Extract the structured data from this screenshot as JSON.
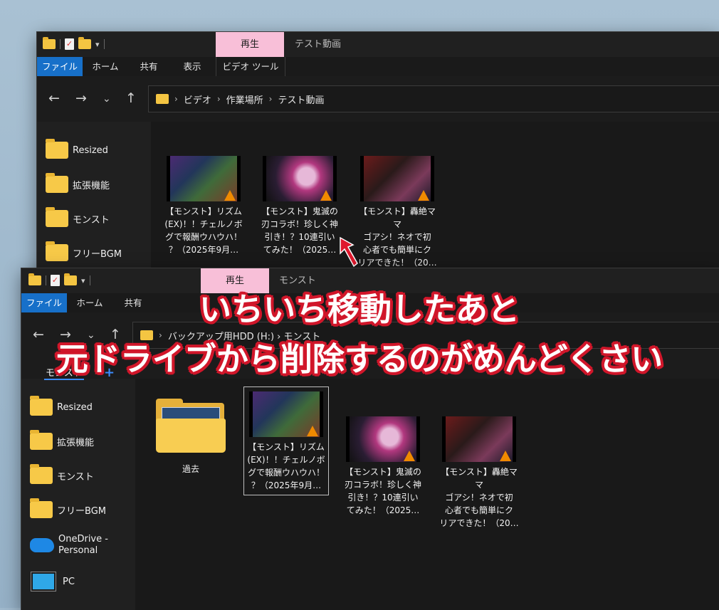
{
  "back_window": {
    "ribbon_context_tab": "再生",
    "title": "テスト動画",
    "tabs": [
      "ファイル",
      "ホーム",
      "共有",
      "表示",
      "ビデオ ツール"
    ],
    "breadcrumb": [
      "ビデオ",
      "作業場所",
      "テスト動画"
    ],
    "sidebar": [
      "Resized",
      "拡張機能",
      "モンスト",
      "フリーBGM"
    ],
    "files": [
      {
        "name": "【モンスト】リズム\n(EX)！！チェルノボ\nグで報酬ウハウハ！\n？（2025年9月…",
        "thumb": "game"
      },
      {
        "name": "【モンスト】鬼滅の\n刃コラボ！珍しく神\n引き！？10連引い\nてみた！（2025…",
        "thumb": "anime"
      },
      {
        "name": "【モンスト】轟絶ママ\nゴアシ！ネオで初\n心者でも簡単にク\nリアできた！（20…",
        "thumb": "dark"
      }
    ]
  },
  "front_window": {
    "ribbon_context_tab": "再生",
    "title": "モンスト",
    "tabs": [
      "ファイル",
      "ホーム",
      "共有"
    ],
    "breadcrumb_partial": "バックアップ用HDD (H:) › モンスト",
    "drag_label": "モンスト",
    "sidebar": [
      "Resized",
      "拡張機能",
      "モンスト",
      "フリーBGM",
      "OneDrive -\nPersonal",
      "PC"
    ],
    "folder": {
      "name": "過去"
    },
    "files": [
      {
        "name": "【モンスト】リズム\n(EX)！！チェルノボ\nグで報酬ウハウハ！\n？（2025年9月…",
        "thumb": "game",
        "selected": true
      },
      {
        "name": "【モンスト】鬼滅の\n刃コラボ！珍しく神\n引き！？10連引い\nてみた！（2025…",
        "thumb": "anime"
      },
      {
        "name": "【モンスト】轟絶ママ\nゴアシ！ネオで初\n心者でも簡単にク\nリアできた！（20…",
        "thumb": "dark"
      }
    ]
  },
  "captions": [
    "いちいち移動したあと",
    "元ドライブから削除するのがめんどくさい"
  ],
  "colors": {
    "accent": "#1770c9",
    "context_tab": "#f8bfd8",
    "caption_outline": "#d1162a",
    "folder": "#f7c948"
  }
}
